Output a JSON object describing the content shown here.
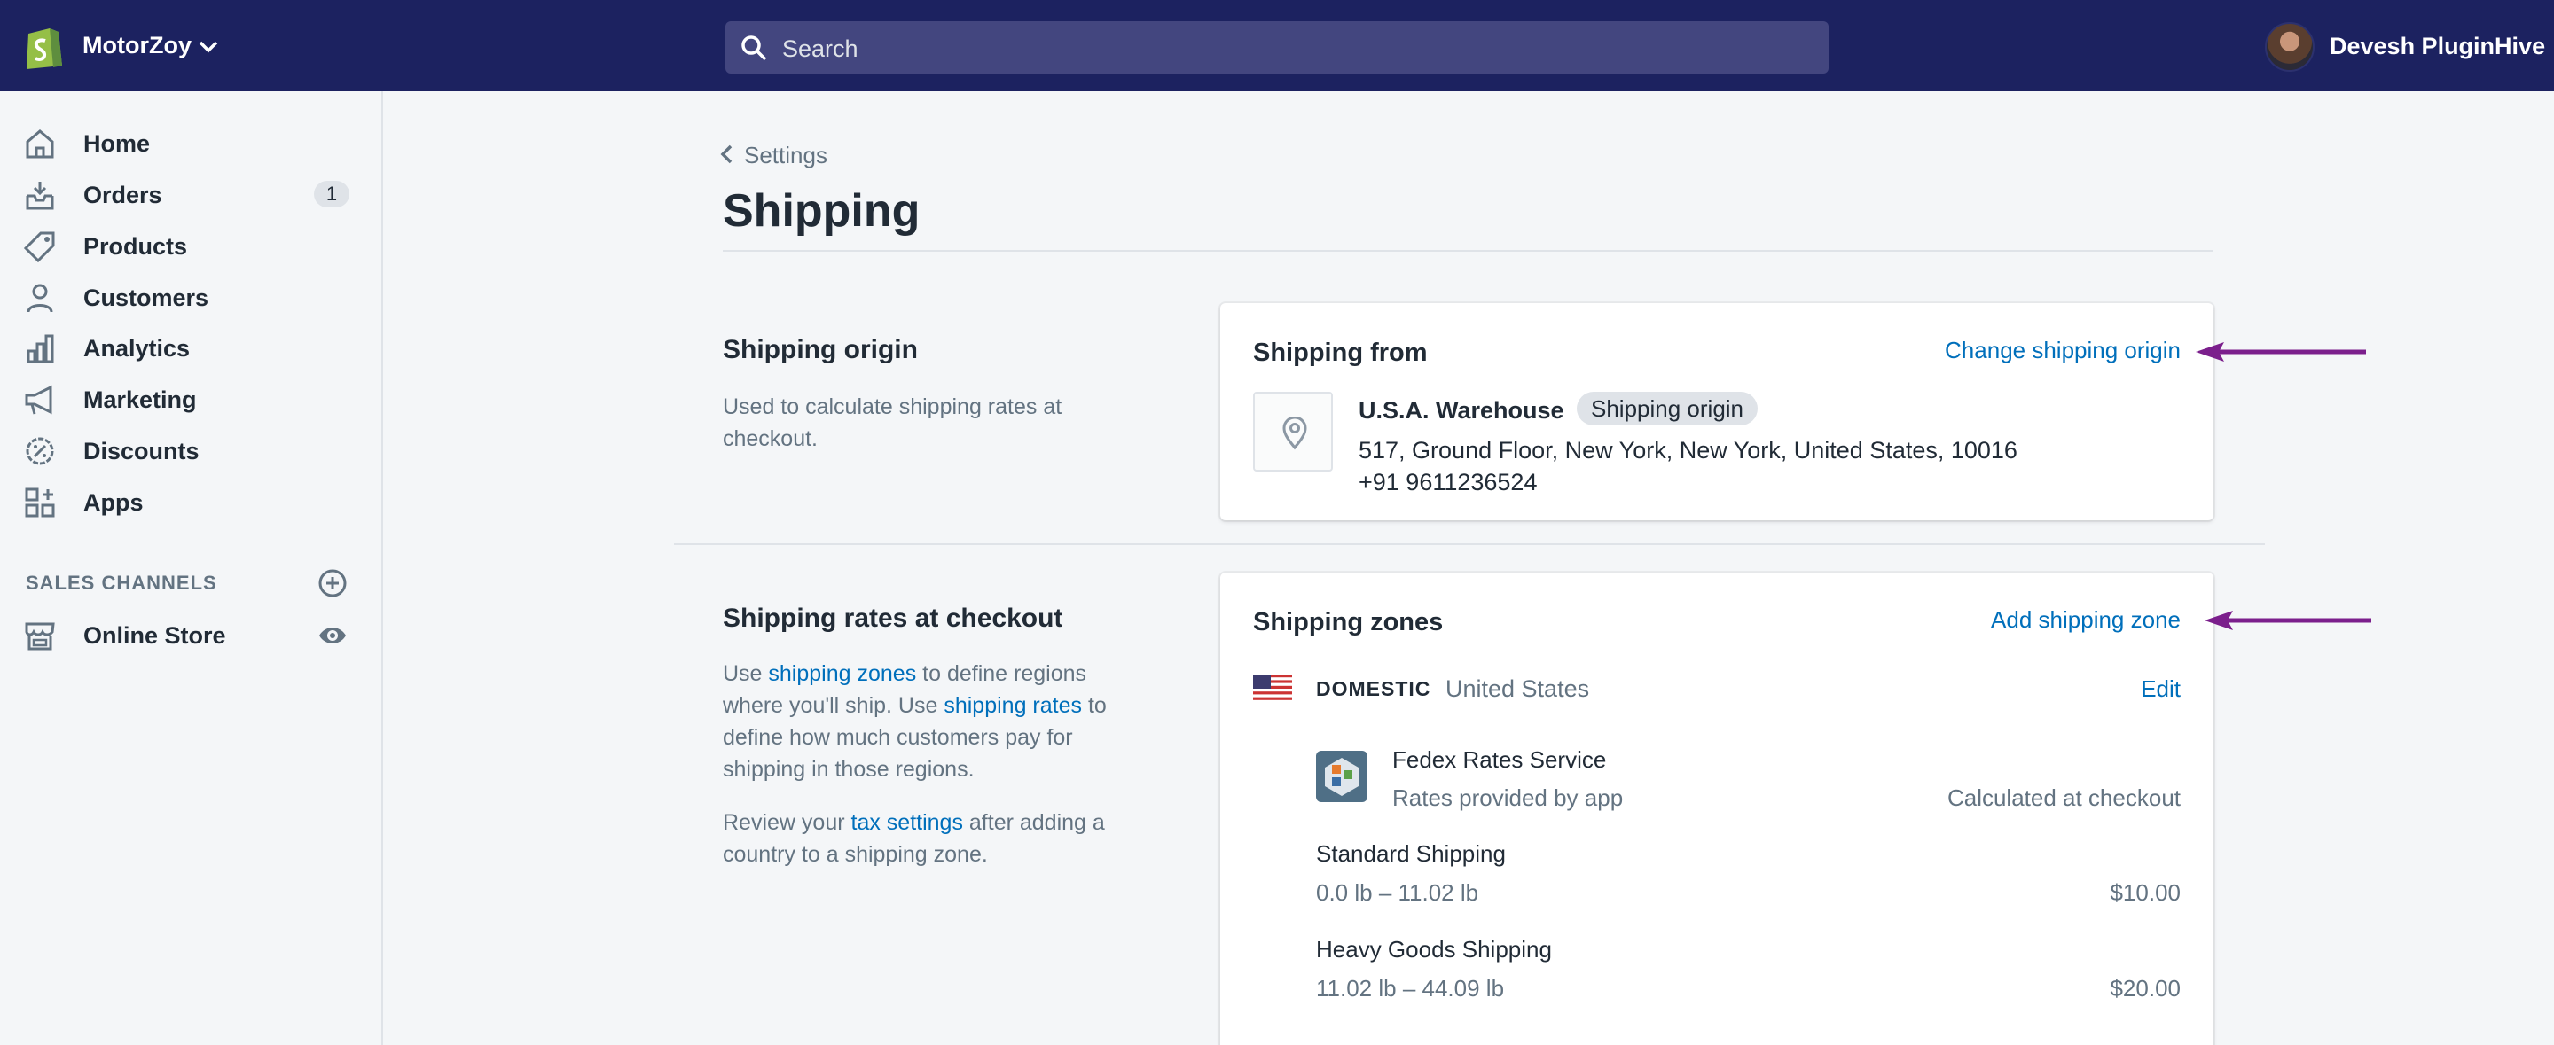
{
  "topbar": {
    "store_name": "MotorZoy",
    "search_placeholder": "Search",
    "user_name": "Devesh PluginHive"
  },
  "sidebar": {
    "items": [
      {
        "label": "Home",
        "icon": "home-icon"
      },
      {
        "label": "Orders",
        "icon": "orders-icon",
        "badge": "1"
      },
      {
        "label": "Products",
        "icon": "tag-icon"
      },
      {
        "label": "Customers",
        "icon": "person-icon"
      },
      {
        "label": "Analytics",
        "icon": "bar-chart-icon"
      },
      {
        "label": "Marketing",
        "icon": "megaphone-icon"
      },
      {
        "label": "Discounts",
        "icon": "discount-icon"
      },
      {
        "label": "Apps",
        "icon": "apps-icon"
      }
    ],
    "sales_channels_title": "SALES CHANNELS",
    "channels": [
      {
        "label": "Online Store",
        "icon": "store-icon"
      }
    ]
  },
  "main": {
    "breadcrumb": "Settings",
    "title": "Shipping",
    "origin_section": {
      "heading": "Shipping origin",
      "description": "Used to calculate shipping rates at checkout."
    },
    "origin_card": {
      "title": "Shipping from",
      "action": "Change shipping origin",
      "location_name": "U.S.A. Warehouse",
      "badge": "Shipping origin",
      "address": "517, Ground Floor, New York, New York, United States, 10016",
      "phone": "+91 9611236524"
    },
    "rates_section": {
      "heading": "Shipping rates at checkout",
      "desc_p1_a": "Use ",
      "desc_p1_link1": "shipping zones",
      "desc_p1_b": " to define regions where you'll ship. Use ",
      "desc_p1_link2": "shipping rates",
      "desc_p1_c": " to define how much customers pay for shipping in those regions.",
      "desc_p2_a": "Review your ",
      "desc_p2_link": "tax settings",
      "desc_p2_b": " after adding a country to a shipping zone."
    },
    "zones_card": {
      "title": "Shipping zones",
      "action": "Add shipping zone",
      "zone": {
        "tag": "DOMESTIC",
        "country": "United States",
        "edit": "Edit",
        "app_service": {
          "name": "Fedex Rates Service",
          "sub": "Rates provided by app",
          "right": "Calculated at checkout"
        },
        "rates": [
          {
            "name": "Standard Shipping",
            "range": "0.0 lb – 11.02 lb",
            "price": "$10.00"
          },
          {
            "name": "Heavy Goods Shipping",
            "range": "11.02 lb – 44.09 lb",
            "price": "$20.00"
          }
        ]
      }
    }
  },
  "colors": {
    "topbar": "#1c2260",
    "link": "#006fbb",
    "annotation_arrow": "#7b1f8c"
  }
}
